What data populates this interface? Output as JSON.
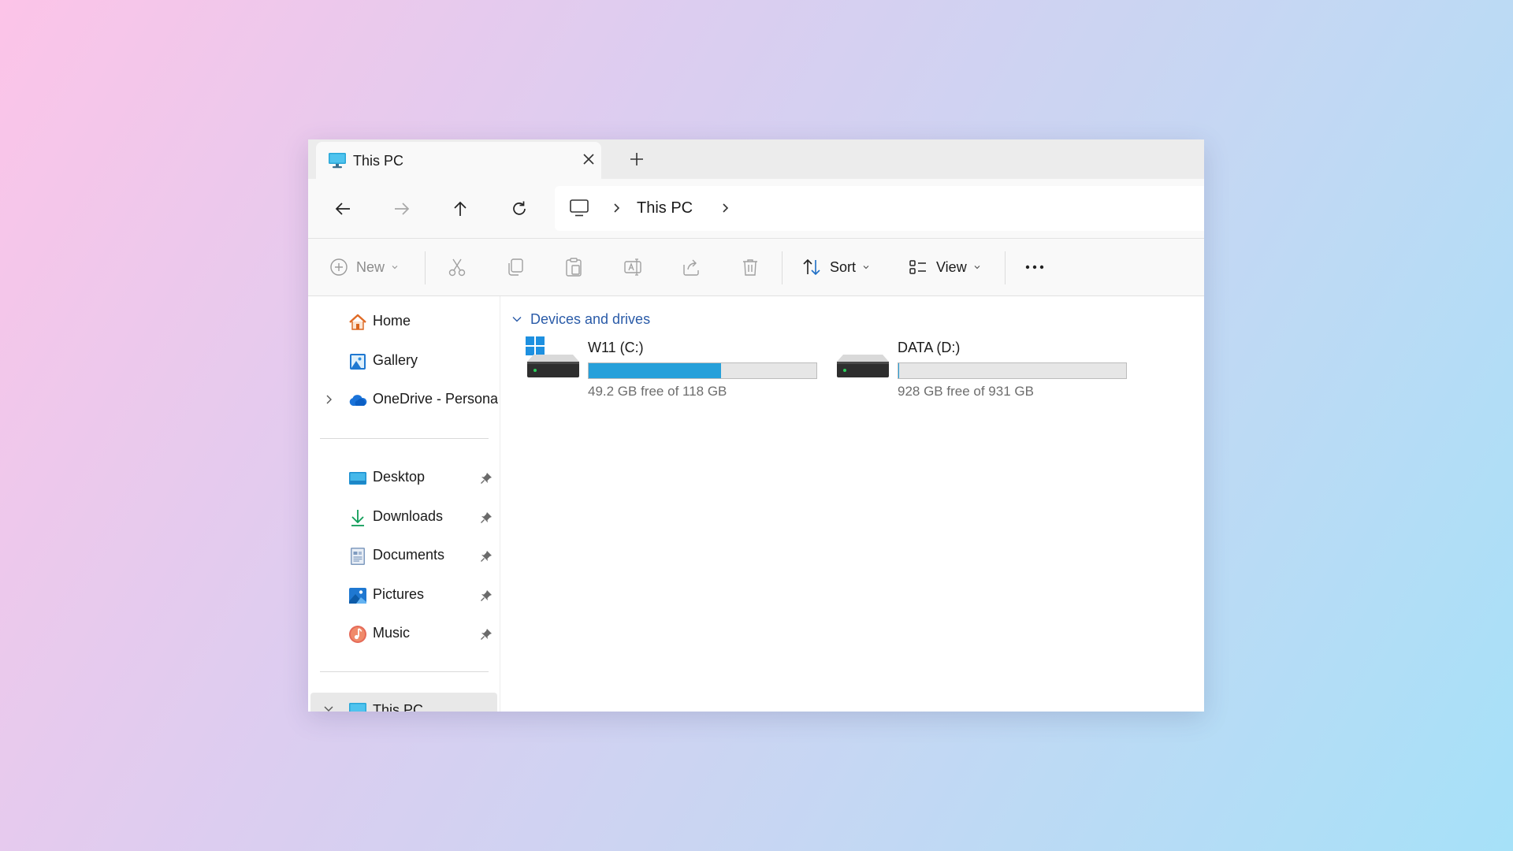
{
  "window": {
    "tab": {
      "title": "This PC",
      "icon": "monitor-icon"
    },
    "address": {
      "root_icon": "monitor-icon",
      "crumbs": [
        "This PC"
      ]
    },
    "commands": {
      "new": "New",
      "sort": "Sort",
      "view": "View",
      "icons": [
        "add-circle-icon",
        "cut-icon",
        "copy-icon",
        "paste-icon",
        "rename-icon",
        "share-icon",
        "delete-icon",
        "sort-icon",
        "view-icon",
        "more-icon"
      ]
    },
    "sidebar": {
      "top": [
        {
          "label": "Home",
          "icon": "home-icon"
        },
        {
          "label": "Gallery",
          "icon": "gallery-icon"
        },
        {
          "label": "OneDrive - Persona",
          "icon": "onedrive-icon"
        }
      ],
      "pinned": [
        {
          "label": "Desktop",
          "icon": "desktop-icon"
        },
        {
          "label": "Downloads",
          "icon": "downloads-icon"
        },
        {
          "label": "Documents",
          "icon": "documents-icon"
        },
        {
          "label": "Pictures",
          "icon": "pictures-icon"
        },
        {
          "label": "Music",
          "icon": "music-icon"
        }
      ],
      "bottom": [
        {
          "label": "This PC",
          "icon": "monitor-icon"
        }
      ]
    },
    "content": {
      "group": "Devices and drives",
      "drives": [
        {
          "name": "W11 (C:)",
          "free_text": "49.2 GB free of 118 GB",
          "used_fraction": 0.583,
          "bar_color": "#26a0da",
          "icon": "windows-drive-icon"
        },
        {
          "name": "DATA (D:)",
          "free_text": "928 GB free of 931 GB",
          "used_fraction": 0.003,
          "bar_color": "#26a0da",
          "icon": "drive-icon"
        }
      ]
    }
  }
}
